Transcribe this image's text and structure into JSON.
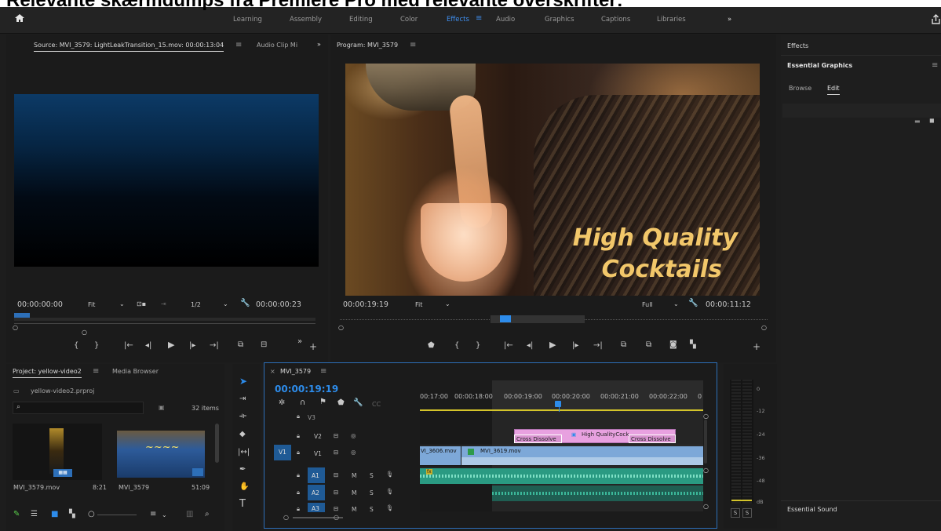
{
  "heading": "Relevante skærmdumps fra Premiere Pro med relevante overskrifter:",
  "workspaces": [
    "Learning",
    "Assembly",
    "Editing",
    "Color",
    "Effects",
    "Audio",
    "Graphics",
    "Captions",
    "Libraries"
  ],
  "active_workspace": "Effects",
  "source_monitor": {
    "title": "Source: MVI_3579: LightLeakTransition_15.mov: 00:00:13:04",
    "tab2": "Audio Clip Mi",
    "timecode": "00:00:00:00",
    "fit": "Fit",
    "resolution": "1/2",
    "duration": "00:00:00:23"
  },
  "program_monitor": {
    "title": "Program: MVI_3579",
    "overlay_line1": "High Quality",
    "overlay_line2": "Cocktails",
    "timecode": "00:00:19:19",
    "fit": "Fit",
    "quality": "Full",
    "duration": "00:00:11:12"
  },
  "right_panel": {
    "effects": "Effects",
    "essential_graphics": "Essential Graphics",
    "tab_browse": "Browse",
    "tab_edit": "Edit",
    "essential_sound": "Essential Sound"
  },
  "project": {
    "tab": "Project: yellow-video2",
    "tab2": "Media Browser",
    "file": "yellow-video2.prproj",
    "count": "32 items",
    "items": [
      {
        "name": "MVI_3579.mov",
        "duration": "8:21"
      },
      {
        "name": "MVI_3579",
        "duration": "51:09"
      }
    ]
  },
  "timeline": {
    "tab": "MVI_3579",
    "timecode": "00:00:19:19",
    "ruler": [
      "00:17:00",
      "00:00:18:00",
      "00:00:19:00",
      "00:00:20:00",
      "00:00:21:00",
      "00:00:22:00",
      "0"
    ],
    "tracks": {
      "v3": "V3",
      "v2": "V2",
      "v1": "V1",
      "a1": "A1",
      "a2": "A2",
      "a3": "A3",
      "src_v1": "V1",
      "m": "M",
      "s": "S"
    },
    "clips": {
      "cross1": "Cross Dissolve",
      "graphic": "High QualityCock",
      "cross2": "Cross Dissolve",
      "v1a": "VI_3606.mov",
      "v1b": "MVI_3619.mov",
      "fx": "fx"
    }
  },
  "meter": {
    "scale": [
      "0",
      "-12",
      "-24",
      "-36",
      "-48",
      "dB"
    ],
    "s1": "S",
    "s2": "S"
  },
  "colors": {
    "accent": "#2d8ceb",
    "cross_dissolve": "#e8a1e0",
    "video_clip": "#7da8d8",
    "audio_clip": "#2a9a82",
    "overlay_text": "#f2c76a"
  }
}
